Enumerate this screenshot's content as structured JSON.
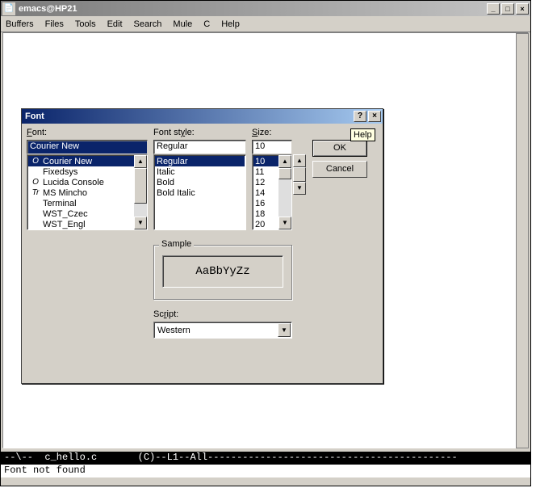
{
  "mainWindow": {
    "title": "emacs@HP21",
    "minimize": "_",
    "maximize": "□",
    "close": "×"
  },
  "menu": {
    "buffers": "Buffers",
    "files": "Files",
    "tools": "Tools",
    "edit": "Edit",
    "search": "Search",
    "mule": "Mule",
    "c": "C",
    "help": "Help"
  },
  "modeline": "--\\--  c_hello.c       (C)--L1--All-------------------------------------------",
  "minibuffer": "Font not found",
  "dialog": {
    "title": "Font",
    "helpBtn": "?",
    "closeBtn": "×",
    "fontLabel": "Font:",
    "fontValue": "Courier New",
    "styleLabel": "Font style:",
    "styleValue": "Regular",
    "sizeLabel": "Size:",
    "sizeValue": "10",
    "ok": "OK",
    "cancel": "Cancel",
    "helpTip": "Help",
    "fontList": [
      {
        "icon": "O",
        "name": "Courier New",
        "sel": true
      },
      {
        "icon": "",
        "name": "Fixedsys"
      },
      {
        "icon": "O",
        "name": "Lucida Console"
      },
      {
        "icon": "Tr",
        "name": "MS Mincho"
      },
      {
        "icon": "",
        "name": "Terminal"
      },
      {
        "icon": "",
        "name": "WST_Czec"
      },
      {
        "icon": "",
        "name": "WST_Engl"
      }
    ],
    "styleList": [
      {
        "name": "Regular",
        "sel": true
      },
      {
        "name": "Italic"
      },
      {
        "name": "Bold"
      },
      {
        "name": "Bold Italic"
      }
    ],
    "sizeList": [
      {
        "name": "10",
        "sel": true
      },
      {
        "name": "11"
      },
      {
        "name": "12"
      },
      {
        "name": "14"
      },
      {
        "name": "16"
      },
      {
        "name": "18"
      },
      {
        "name": "20"
      }
    ],
    "sampleLabel": "Sample",
    "sampleText": "AaBbYyZz",
    "scriptLabel": "Script:",
    "scriptValue": "Western"
  }
}
